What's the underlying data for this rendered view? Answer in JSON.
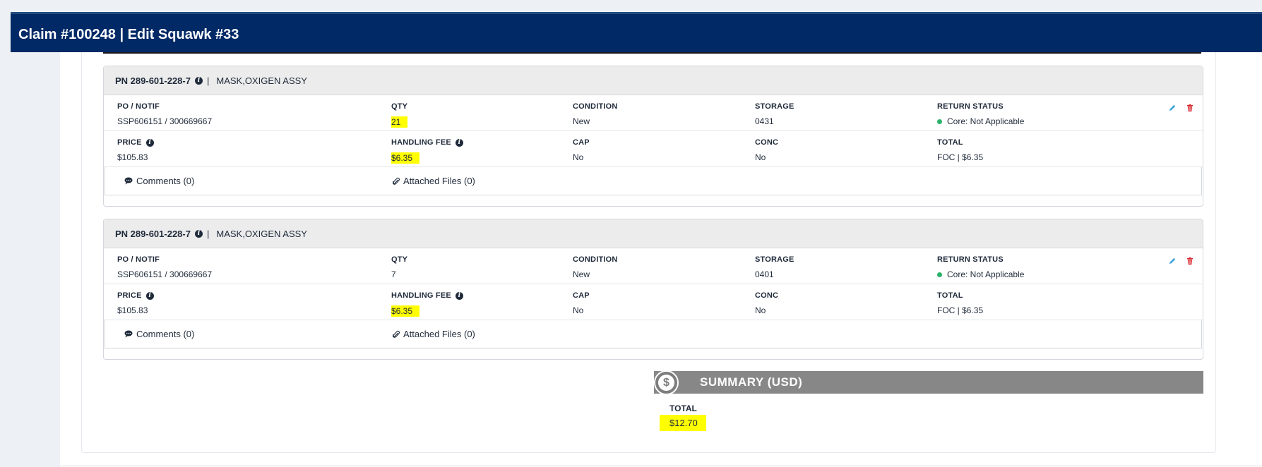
{
  "header": {
    "title": "Claim #100248 | Edit Squawk #33"
  },
  "labels": {
    "po_notif": "PO / NOTIF",
    "qty": "QTY",
    "condition": "CONDITION",
    "storage": "STORAGE",
    "return_status": "RETURN STATUS",
    "price": "PRICE",
    "handling_fee": "HANDLING FEE",
    "cap": "CAP",
    "conc": "CONC",
    "total": "TOTAL"
  },
  "parts": [
    {
      "pn": "PN 289-601-228-7",
      "desc": "MASK,OXIGEN ASSY",
      "po_notif": "SSP606151 / 300669667",
      "qty": "21",
      "condition": "New",
      "storage": "0431",
      "return_status": "Core: Not Applicable",
      "price": "$105.83",
      "handling_fee": "$6.35",
      "cap": "No",
      "conc": "No",
      "total": "FOC | $6.35",
      "comments": "Comments (0)",
      "files": "Attached Files (0)"
    },
    {
      "pn": "PN 289-601-228-7",
      "desc": "MASK,OXIGEN ASSY",
      "po_notif": "SSP606151 / 300669667",
      "qty": "7",
      "condition": "New",
      "storage": "0401",
      "return_status": "Core: Not Applicable",
      "price": "$105.83",
      "handling_fee": "$6.35",
      "cap": "No",
      "conc": "No",
      "total": "FOC | $6.35",
      "comments": "Comments (0)",
      "files": "Attached Files (0)"
    }
  ],
  "summary": {
    "title": "SUMMARY (USD)",
    "icon_glyph": "$",
    "total_label": "TOTAL",
    "total_value": "$12.70"
  },
  "colors": {
    "header_bg": "#002966",
    "highlight": "#ffff00",
    "status_ok": "#2bb26b",
    "edit_icon": "#3aa3d8",
    "delete_icon": "#d9262c",
    "summary_bar": "#878787"
  },
  "icons": [
    "info-icon",
    "pencil-icon",
    "trash-icon",
    "comment-icon",
    "paperclip-icon",
    "dollar-icon"
  ]
}
